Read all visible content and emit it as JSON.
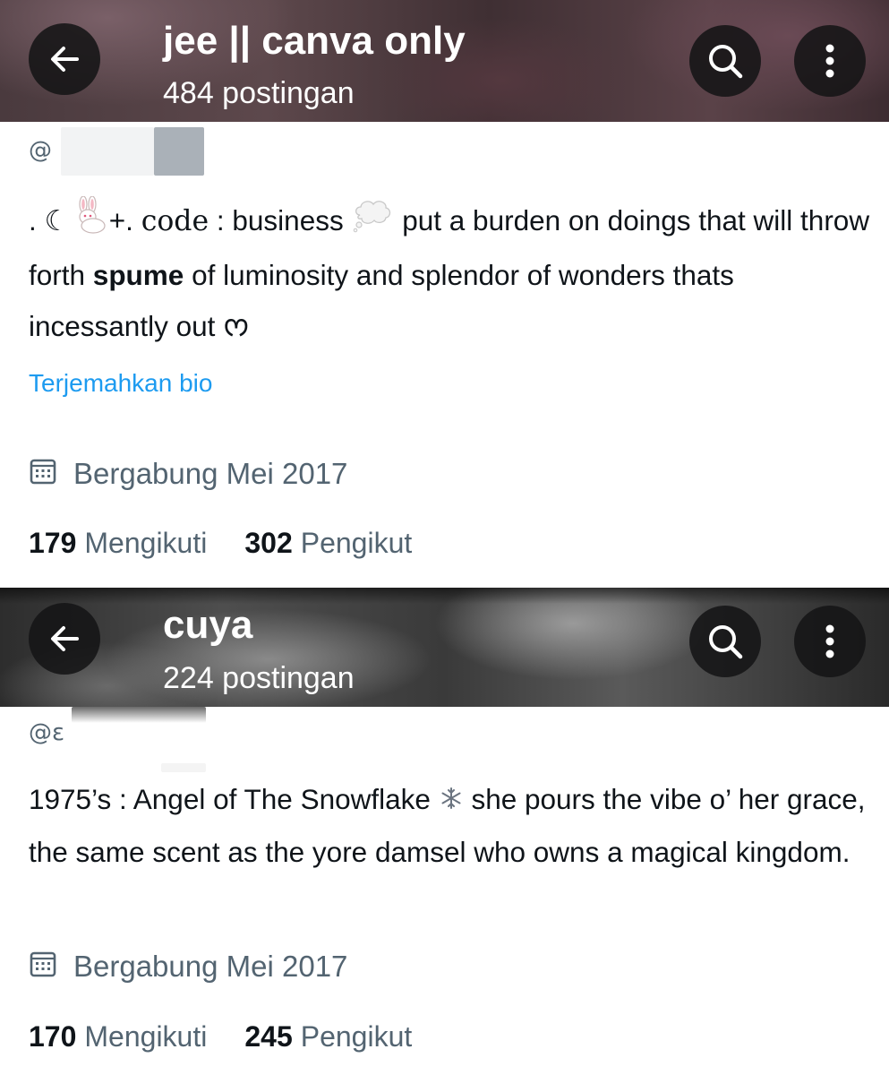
{
  "profiles": [
    {
      "header": {
        "back_icon": "arrow-left-icon",
        "title": "jee || canva only",
        "post_count": "484 postingan",
        "search_icon": "search-icon",
        "more_icon": "more-vertical-icon"
      },
      "handle": "@",
      "bio": {
        "prefix": ".",
        "moon": "☾",
        "rabbit": "🐇",
        "part1": "+.",
        "code_word": "code",
        "part2": ": business",
        "thought_bubble": "💭",
        "part3": "put a burden on doings that will throw forth",
        "bold_word": "spume",
        "part4": "of luminosity and splendor of wonders thats incessantly out",
        "end_symbol": "ᰔ"
      },
      "translate_link": "Terjemahkan bio",
      "joined": "Bergabung Mei 2017",
      "following_count": "179",
      "following_label": "Mengikuti",
      "followers_count": "302",
      "followers_label": "Pengikut"
    },
    {
      "header": {
        "back_icon": "arrow-left-icon",
        "title": "cuya",
        "post_count": "224 postingan",
        "search_icon": "search-icon",
        "more_icon": "more-vertical-icon"
      },
      "handle": "@ε",
      "bio": {
        "part1": "1975’s : Angel of The Snowflake",
        "snowflake": "❄",
        "part2": "she pours the vibe o’ her grace, the same scent as the yore damsel who owns a magical kingdom."
      },
      "joined": "Bergabung Mei 2017",
      "following_count": "170",
      "following_label": "Mengikuti",
      "followers_count": "245",
      "followers_label": "Pengikut"
    }
  ],
  "colors": {
    "text_primary": "#0f1419",
    "text_secondary": "#536471",
    "link": "#1d9bf0",
    "header_button_bg": "#141416"
  }
}
